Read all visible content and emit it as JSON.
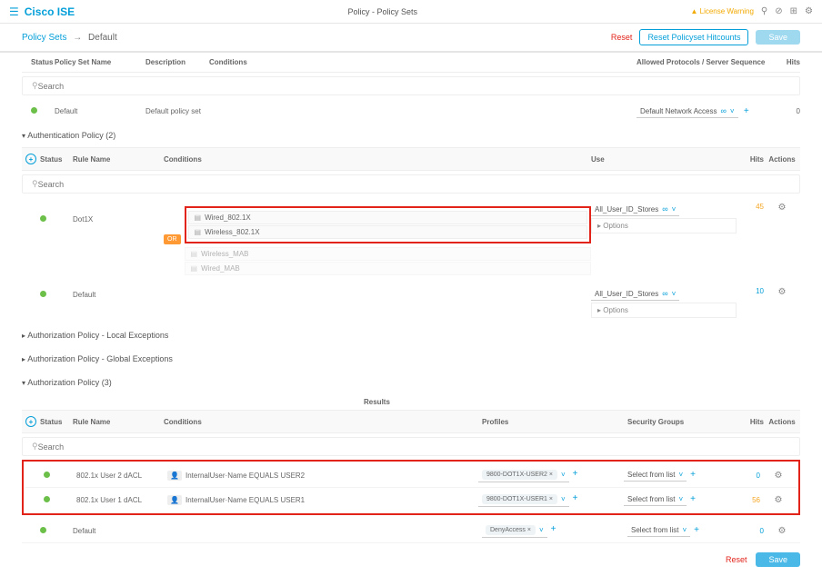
{
  "topbar": {
    "brand": "Cisco ISE",
    "breadcrumb_center": "Policy - Policy Sets",
    "warning": "License Warning"
  },
  "breadcrumb": {
    "root": "Policy Sets",
    "arrow": "→",
    "current": "Default",
    "reset": "Reset",
    "reset_hitcounts": "Reset Policyset Hitcounts",
    "save": "Save"
  },
  "policy_sets": {
    "headers": {
      "status": "Status",
      "name": "Policy Set Name",
      "description": "Description",
      "conditions": "Conditions",
      "allowed": "Allowed Protocols / Server Sequence",
      "hits": "Hits"
    },
    "search_placeholder": "Search",
    "row": {
      "name": "Default",
      "description": "Default policy set",
      "allowed": "Default Network Access",
      "hits": "0"
    }
  },
  "authn": {
    "title": "Authentication Policy (2)",
    "headers": {
      "status": "Status",
      "rule": "Rule Name",
      "conditions": "Conditions",
      "use": "Use",
      "hits": "Hits",
      "actions": "Actions"
    },
    "search_placeholder": "Search",
    "dot1x": {
      "name": "Dot1X",
      "or": "OR",
      "conds": [
        "Wired_802.1X",
        "Wireless_802.1X",
        "Wireless_MAB",
        "Wired_MAB"
      ],
      "use": "All_User_ID_Stores",
      "options": "Options",
      "hits": "45"
    },
    "default": {
      "name": "Default",
      "use": "All_User_ID_Stores",
      "options": "Options",
      "hits": "10"
    }
  },
  "authz": {
    "local_exc": "Authorization Policy - Local Exceptions",
    "global_exc": "Authorization Policy - Global Exceptions",
    "title": "Authorization Policy (3)",
    "results_label": "Results",
    "headers": {
      "status": "Status",
      "rule": "Rule Name",
      "conditions": "Conditions",
      "profiles": "Profiles",
      "sg": "Security Groups",
      "hits": "Hits",
      "actions": "Actions"
    },
    "search_placeholder": "Search",
    "rows": [
      {
        "name": "802.1x User 2 dACL",
        "cond": "InternalUser·Name EQUALS USER2",
        "profile": "9800-DOT1X-USER2 ×",
        "sg": "Select from list",
        "hits": "0"
      },
      {
        "name": "802.1x User 1 dACL",
        "cond": "InternalUser·Name EQUALS USER1",
        "profile": "9800-DOT1X-USER1 ×",
        "sg": "Select from list",
        "hits": "56"
      }
    ],
    "default": {
      "name": "Default",
      "profile": "DenyAccess ×",
      "sg": "Select from list",
      "hits": "0"
    }
  },
  "footer": {
    "reset": "Reset",
    "save": "Save"
  }
}
